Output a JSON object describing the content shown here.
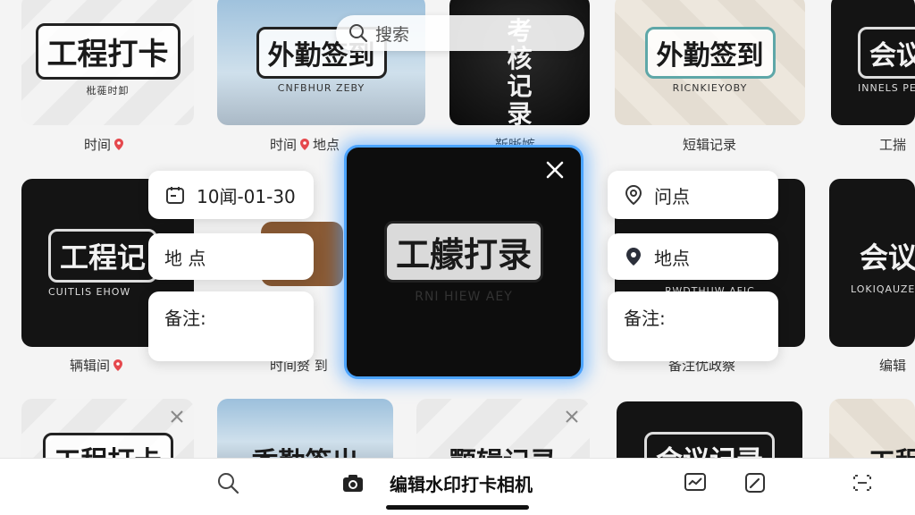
{
  "search": {
    "placeholder": "搜索"
  },
  "tiles": {
    "t1": {
      "title": "工程打卡",
      "sub": "枇蓰时卸",
      "caption": "时间"
    },
    "t2": {
      "title": "外勤签到",
      "sub": "CNFBHUR ZEBY",
      "caption": "时间",
      "caption2": "地点"
    },
    "t3": {
      "title": "考核记录",
      "caption": "靳晰嫉"
    },
    "t4": {
      "title": "外勤签到",
      "sub": "RICNKIEYOBY",
      "caption": "短辑记录"
    },
    "t5": {
      "title": "会议",
      "sub": "INNELS PERY",
      "caption": "工揣"
    },
    "t6": {
      "title": "工程记",
      "sub": "CUITLIS EHOW",
      "caption": "辆辑间"
    },
    "t7": {
      "caption": "时间赘 到"
    },
    "t8": {
      "sub": "RWDTHUW AFJC",
      "caption": "备注优政察"
    },
    "t9": {
      "title": "会议",
      "sub": "LOKIQAUZE",
      "caption": "编辑"
    },
    "t10": {
      "title": "工程打卡"
    },
    "t11": {
      "title": "香勤签出"
    },
    "t12": {
      "title": "颚辑记录"
    },
    "t13": {
      "title": "会议记录"
    },
    "t14": {
      "title": "工程"
    }
  },
  "left_panel": {
    "date": "10闻-01-30",
    "location": "地 点",
    "note": "备注:"
  },
  "right_panel": {
    "location_top": "问点",
    "location": "地点",
    "note": "备注:"
  },
  "focus": {
    "title": "工艨打录",
    "sub": "RNI HIEW AEY"
  },
  "bottombar": {
    "title": "编辑水印打卡相机"
  },
  "colors": {
    "accent": "#4aa3ff",
    "pin": "#e5484d"
  },
  "icons": [
    "search-icon",
    "calendar-icon",
    "location-pin-icon",
    "close-icon",
    "camera-icon",
    "chart-icon",
    "edit-icon",
    "scan-icon"
  ]
}
